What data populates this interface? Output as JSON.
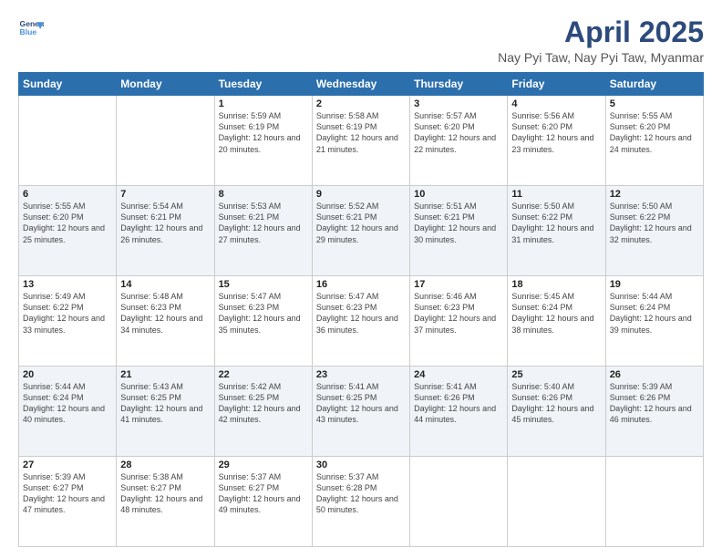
{
  "header": {
    "logo_line1": "General",
    "logo_line2": "Blue",
    "title": "April 2025",
    "subtitle": "Nay Pyi Taw, Nay Pyi Taw, Myanmar"
  },
  "weekdays": [
    "Sunday",
    "Monday",
    "Tuesday",
    "Wednesday",
    "Thursday",
    "Friday",
    "Saturday"
  ],
  "weeks": [
    [
      {
        "day": "",
        "sunrise": "",
        "sunset": "",
        "daylight": ""
      },
      {
        "day": "",
        "sunrise": "",
        "sunset": "",
        "daylight": ""
      },
      {
        "day": "1",
        "sunrise": "Sunrise: 5:59 AM",
        "sunset": "Sunset: 6:19 PM",
        "daylight": "Daylight: 12 hours and 20 minutes."
      },
      {
        "day": "2",
        "sunrise": "Sunrise: 5:58 AM",
        "sunset": "Sunset: 6:19 PM",
        "daylight": "Daylight: 12 hours and 21 minutes."
      },
      {
        "day": "3",
        "sunrise": "Sunrise: 5:57 AM",
        "sunset": "Sunset: 6:20 PM",
        "daylight": "Daylight: 12 hours and 22 minutes."
      },
      {
        "day": "4",
        "sunrise": "Sunrise: 5:56 AM",
        "sunset": "Sunset: 6:20 PM",
        "daylight": "Daylight: 12 hours and 23 minutes."
      },
      {
        "day": "5",
        "sunrise": "Sunrise: 5:55 AM",
        "sunset": "Sunset: 6:20 PM",
        "daylight": "Daylight: 12 hours and 24 minutes."
      }
    ],
    [
      {
        "day": "6",
        "sunrise": "Sunrise: 5:55 AM",
        "sunset": "Sunset: 6:20 PM",
        "daylight": "Daylight: 12 hours and 25 minutes."
      },
      {
        "day": "7",
        "sunrise": "Sunrise: 5:54 AM",
        "sunset": "Sunset: 6:21 PM",
        "daylight": "Daylight: 12 hours and 26 minutes."
      },
      {
        "day": "8",
        "sunrise": "Sunrise: 5:53 AM",
        "sunset": "Sunset: 6:21 PM",
        "daylight": "Daylight: 12 hours and 27 minutes."
      },
      {
        "day": "9",
        "sunrise": "Sunrise: 5:52 AM",
        "sunset": "Sunset: 6:21 PM",
        "daylight": "Daylight: 12 hours and 29 minutes."
      },
      {
        "day": "10",
        "sunrise": "Sunrise: 5:51 AM",
        "sunset": "Sunset: 6:21 PM",
        "daylight": "Daylight: 12 hours and 30 minutes."
      },
      {
        "day": "11",
        "sunrise": "Sunrise: 5:50 AM",
        "sunset": "Sunset: 6:22 PM",
        "daylight": "Daylight: 12 hours and 31 minutes."
      },
      {
        "day": "12",
        "sunrise": "Sunrise: 5:50 AM",
        "sunset": "Sunset: 6:22 PM",
        "daylight": "Daylight: 12 hours and 32 minutes."
      }
    ],
    [
      {
        "day": "13",
        "sunrise": "Sunrise: 5:49 AM",
        "sunset": "Sunset: 6:22 PM",
        "daylight": "Daylight: 12 hours and 33 minutes."
      },
      {
        "day": "14",
        "sunrise": "Sunrise: 5:48 AM",
        "sunset": "Sunset: 6:23 PM",
        "daylight": "Daylight: 12 hours and 34 minutes."
      },
      {
        "day": "15",
        "sunrise": "Sunrise: 5:47 AM",
        "sunset": "Sunset: 6:23 PM",
        "daylight": "Daylight: 12 hours and 35 minutes."
      },
      {
        "day": "16",
        "sunrise": "Sunrise: 5:47 AM",
        "sunset": "Sunset: 6:23 PM",
        "daylight": "Daylight: 12 hours and 36 minutes."
      },
      {
        "day": "17",
        "sunrise": "Sunrise: 5:46 AM",
        "sunset": "Sunset: 6:23 PM",
        "daylight": "Daylight: 12 hours and 37 minutes."
      },
      {
        "day": "18",
        "sunrise": "Sunrise: 5:45 AM",
        "sunset": "Sunset: 6:24 PM",
        "daylight": "Daylight: 12 hours and 38 minutes."
      },
      {
        "day": "19",
        "sunrise": "Sunrise: 5:44 AM",
        "sunset": "Sunset: 6:24 PM",
        "daylight": "Daylight: 12 hours and 39 minutes."
      }
    ],
    [
      {
        "day": "20",
        "sunrise": "Sunrise: 5:44 AM",
        "sunset": "Sunset: 6:24 PM",
        "daylight": "Daylight: 12 hours and 40 minutes."
      },
      {
        "day": "21",
        "sunrise": "Sunrise: 5:43 AM",
        "sunset": "Sunset: 6:25 PM",
        "daylight": "Daylight: 12 hours and 41 minutes."
      },
      {
        "day": "22",
        "sunrise": "Sunrise: 5:42 AM",
        "sunset": "Sunset: 6:25 PM",
        "daylight": "Daylight: 12 hours and 42 minutes."
      },
      {
        "day": "23",
        "sunrise": "Sunrise: 5:41 AM",
        "sunset": "Sunset: 6:25 PM",
        "daylight": "Daylight: 12 hours and 43 minutes."
      },
      {
        "day": "24",
        "sunrise": "Sunrise: 5:41 AM",
        "sunset": "Sunset: 6:26 PM",
        "daylight": "Daylight: 12 hours and 44 minutes."
      },
      {
        "day": "25",
        "sunrise": "Sunrise: 5:40 AM",
        "sunset": "Sunset: 6:26 PM",
        "daylight": "Daylight: 12 hours and 45 minutes."
      },
      {
        "day": "26",
        "sunrise": "Sunrise: 5:39 AM",
        "sunset": "Sunset: 6:26 PM",
        "daylight": "Daylight: 12 hours and 46 minutes."
      }
    ],
    [
      {
        "day": "27",
        "sunrise": "Sunrise: 5:39 AM",
        "sunset": "Sunset: 6:27 PM",
        "daylight": "Daylight: 12 hours and 47 minutes."
      },
      {
        "day": "28",
        "sunrise": "Sunrise: 5:38 AM",
        "sunset": "Sunset: 6:27 PM",
        "daylight": "Daylight: 12 hours and 48 minutes."
      },
      {
        "day": "29",
        "sunrise": "Sunrise: 5:37 AM",
        "sunset": "Sunset: 6:27 PM",
        "daylight": "Daylight: 12 hours and 49 minutes."
      },
      {
        "day": "30",
        "sunrise": "Sunrise: 5:37 AM",
        "sunset": "Sunset: 6:28 PM",
        "daylight": "Daylight: 12 hours and 50 minutes."
      },
      {
        "day": "",
        "sunrise": "",
        "sunset": "",
        "daylight": ""
      },
      {
        "day": "",
        "sunrise": "",
        "sunset": "",
        "daylight": ""
      },
      {
        "day": "",
        "sunrise": "",
        "sunset": "",
        "daylight": ""
      }
    ]
  ],
  "shading": [
    false,
    true,
    false,
    true,
    false
  ]
}
